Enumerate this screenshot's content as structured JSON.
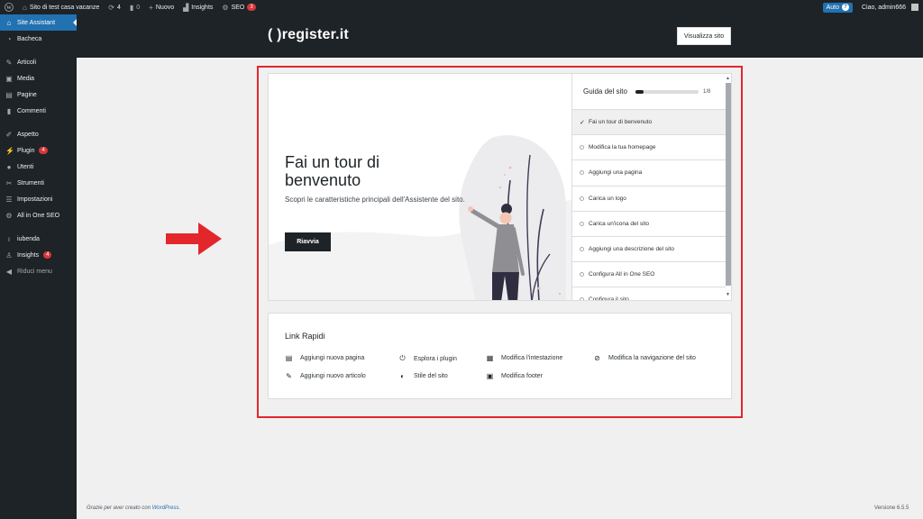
{
  "adminbar": {
    "site_name": "Sito di test casa vacanze",
    "updates_count": "4",
    "comments_count": "0",
    "new_label": "Nuovo",
    "insights_label": "Insights",
    "seo_label": "SEO",
    "seo_badge": "3",
    "auto_label": "Auto",
    "greeting": "Ciao, admin666"
  },
  "sidebar": {
    "items": [
      {
        "label": "Site Assistant",
        "icon": "home-icon"
      },
      {
        "label": "Bacheca",
        "icon": "dashboard-icon"
      },
      {
        "label": "Articoli",
        "icon": "pin-icon"
      },
      {
        "label": "Media",
        "icon": "media-icon"
      },
      {
        "label": "Pagine",
        "icon": "pages-icon"
      },
      {
        "label": "Commenti",
        "icon": "comment-icon"
      },
      {
        "label": "Aspetto",
        "icon": "brush-icon"
      },
      {
        "label": "Plugin",
        "icon": "plugin-icon",
        "badge": "4"
      },
      {
        "label": "Utenti",
        "icon": "user-icon"
      },
      {
        "label": "Strumenti",
        "icon": "wrench-icon"
      },
      {
        "label": "Impostazioni",
        "icon": "settings-icon"
      },
      {
        "label": "All in One SEO",
        "icon": "seo-icon"
      },
      {
        "label": "iubenda",
        "icon": "iubenda-icon"
      },
      {
        "label": "Insights",
        "icon": "insights-icon",
        "badge": "4"
      },
      {
        "label": "Riduci menu",
        "icon": "collapse-icon"
      }
    ]
  },
  "header": {
    "brand": "( )register.it",
    "visit_button": "Visualizza sito"
  },
  "tour": {
    "title": "Fai un tour di benvenuto",
    "description": "Scopri le caratteristiche principali dell'Assistente del sito.",
    "restart_button": "Riavvia"
  },
  "guide": {
    "title": "Guida del sito",
    "progress_text": "1/8",
    "progress_fraction": 0.125,
    "steps": [
      {
        "label": "Fai un tour di benvenuto",
        "done": true
      },
      {
        "label": "Modifica la tua homepage",
        "done": false
      },
      {
        "label": "Aggiungi una pagina",
        "done": false
      },
      {
        "label": "Carica un logo",
        "done": false
      },
      {
        "label": "Carica un'icona del sito",
        "done": false
      },
      {
        "label": "Aggiungi una descrizione del sito",
        "done": false
      },
      {
        "label": "Configura All in One SEO",
        "done": false
      },
      {
        "label": "Configura il sito",
        "done": false
      }
    ]
  },
  "quick_links": {
    "title": "Link Rapidi",
    "items": [
      {
        "label": "Aggiungi nuova pagina",
        "icon": "page-icon"
      },
      {
        "label": "Esplora i plugin",
        "icon": "plug-icon"
      },
      {
        "label": "Modifica l'intestazione",
        "icon": "header-layout-icon"
      },
      {
        "label": "Modifica la navigazione del sito",
        "icon": "compass-icon"
      },
      {
        "label": "Aggiungi nuovo articolo",
        "icon": "post-icon"
      },
      {
        "label": "Stile del sito",
        "icon": "contrast-icon"
      },
      {
        "label": "Modifica footer",
        "icon": "footer-layout-icon"
      }
    ]
  },
  "footer": {
    "thanks_prefix": "Grazie per aver creato con ",
    "thanks_link": "WordPress",
    "thanks_suffix": ".",
    "version": "Versione 6.5.5"
  },
  "colors": {
    "accent": "#2271b1",
    "dark": "#1d2327",
    "highlight": "#e3262c",
    "badge": "#d63638"
  }
}
